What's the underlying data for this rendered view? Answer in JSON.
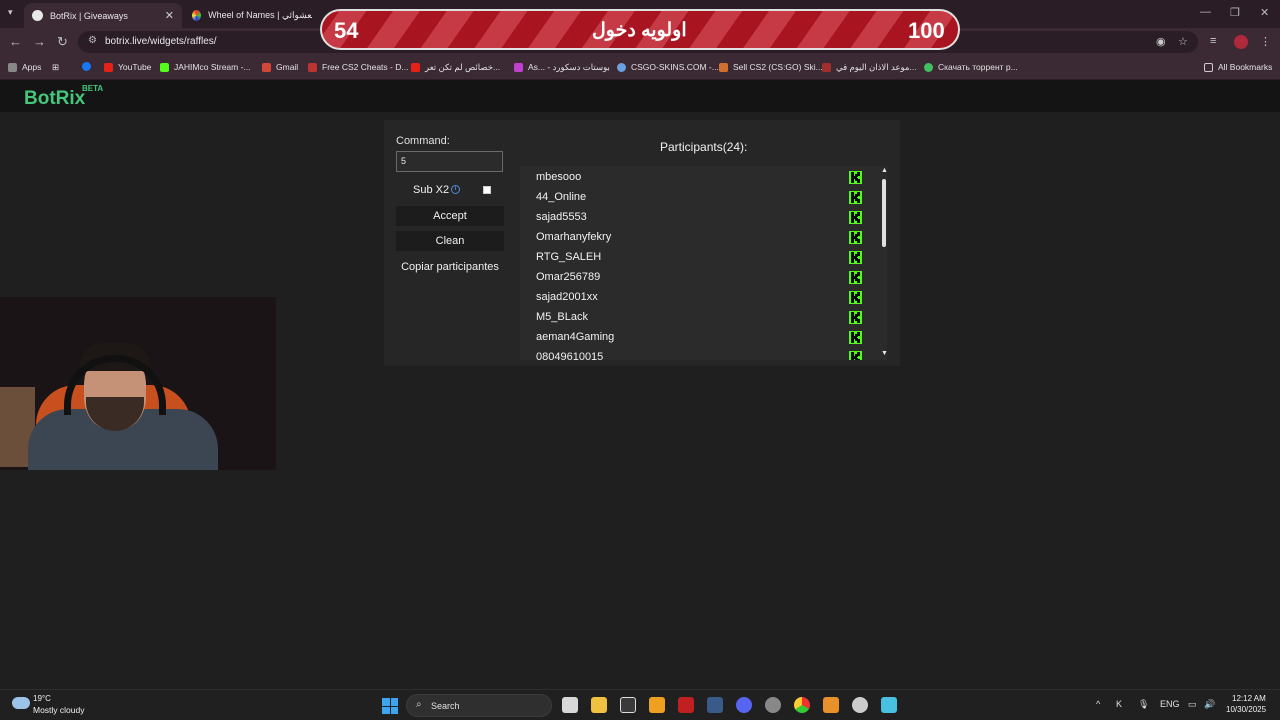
{
  "browser": {
    "tabs": [
      {
        "title": "BotRix | Giveaways",
        "active": true
      },
      {
        "title": "Wheel of Names | سم العشوائي",
        "active": false
      }
    ],
    "url": "botrix.live/widgets/raffles/",
    "bookmarks": [
      {
        "label": "Apps",
        "color": "#888888"
      },
      {
        "label": "YouTube",
        "color": "#e62117"
      },
      {
        "label": "JAHIMco Stream -...",
        "color": "#53fc18"
      },
      {
        "label": "Gmail",
        "color": "#d44638"
      },
      {
        "label": "Free CS2 Cheats - D...",
        "color": "#b33"
      },
      {
        "label": "خصائص لم تكن تعر...",
        "color": "#e62117"
      },
      {
        "label": "As... - بوستات دسكورد",
        "color": "#c040d0"
      },
      {
        "label": "CSGO-SKINS.COM -...",
        "color": "#6aa0e0"
      },
      {
        "label": "Sell CS2 (CS:GO) Ski...",
        "color": "#d07030"
      },
      {
        "label": "موعد الاذان اليوم في...",
        "color": "#a03030"
      },
      {
        "label": "Скачать торрент р...",
        "color": "#40c060"
      }
    ],
    "all_bookmarks": "All Bookmarks"
  },
  "overlay": {
    "left_number": "54",
    "center_text": "اولويه دخول",
    "right_number": "100"
  },
  "app": {
    "logo": "BotRix",
    "logo_badge": "BETA"
  },
  "raffle": {
    "command_label": "Command:",
    "command_value": "5",
    "sub_label": "Sub X2",
    "sub_checked": false,
    "accept_label": "Accept",
    "clean_label": "Clean",
    "copy_label": "Copiar participantes",
    "participants_title": "Participants(24):",
    "participants": [
      "mbesooo",
      "44_Online",
      "sajad5553",
      "Omarhanyfekry",
      "RTG_SALEH",
      "Omar256789",
      "sajad2001xx",
      "M5_BLack",
      "aeman4Gaming",
      "08049610015"
    ],
    "kick_color": "#53fc18"
  },
  "taskbar": {
    "temperature": "19°C",
    "condition": "Mostly cloudy",
    "search_placeholder": "Search",
    "language": "ENG",
    "time": "12:12 AM",
    "date": "10/30/2025"
  }
}
